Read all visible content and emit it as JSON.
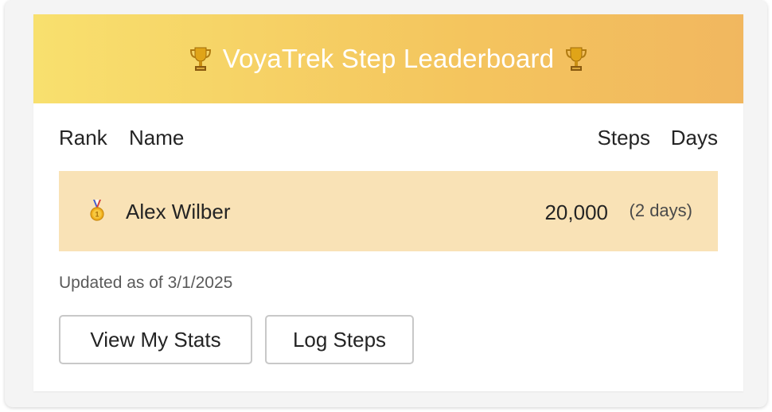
{
  "banner": {
    "title": "VoyaTrek Step Leaderboard",
    "icon_left": "trophy-icon",
    "icon_right": "trophy-icon",
    "gradient_start": "#f8e06e",
    "gradient_end": "#f1b75f"
  },
  "table": {
    "headers": {
      "rank": "Rank",
      "name": "Name",
      "steps": "Steps",
      "days": "Days"
    },
    "rows": [
      {
        "rank_icon": "first-place-medal-icon",
        "name": "Alex Wilber",
        "steps": "20,000",
        "days": "(2 days)",
        "highlight_color": "#f9e2b6"
      }
    ]
  },
  "footer": {
    "updated": "Updated as of 3/1/2025"
  },
  "actions": {
    "view_stats": "View My Stats",
    "log_steps": "Log Steps"
  }
}
